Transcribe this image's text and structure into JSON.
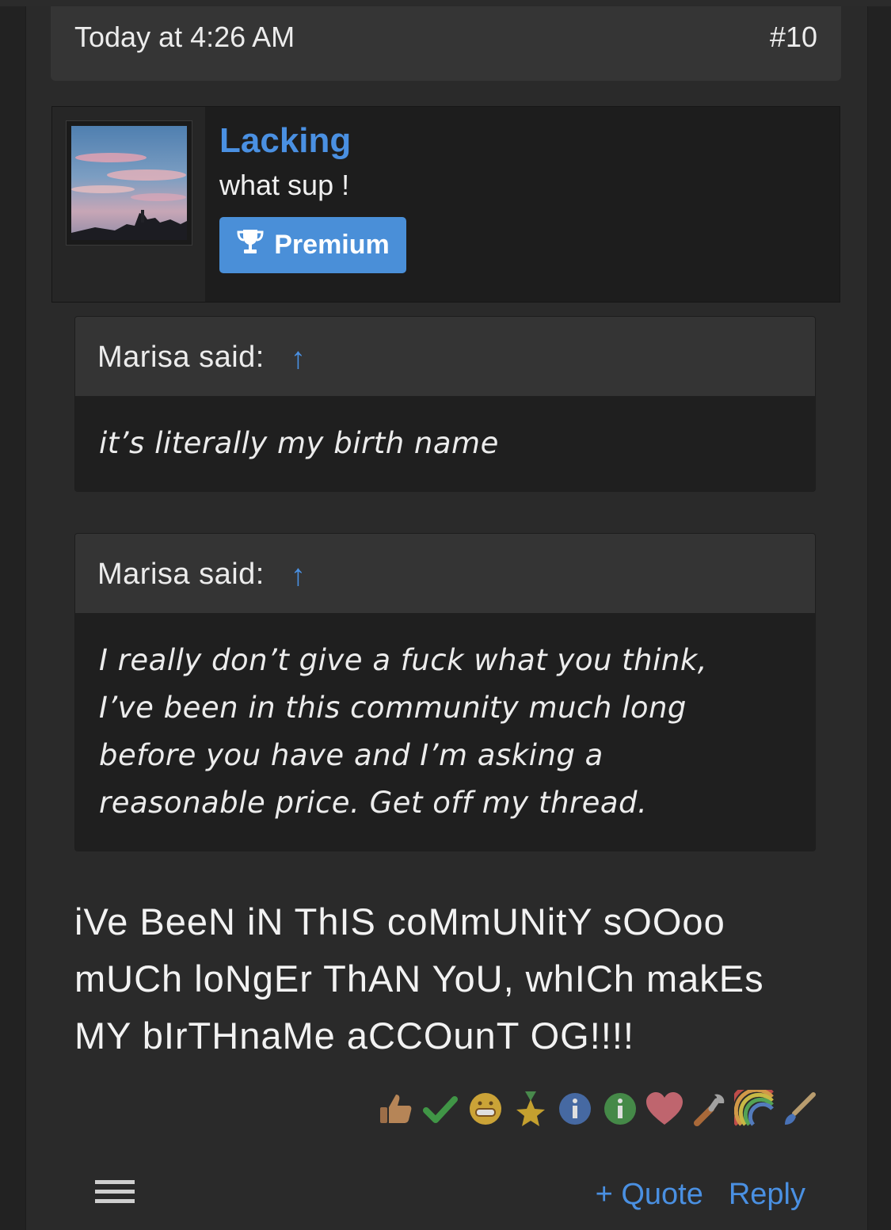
{
  "post": {
    "date": "Today at 4:26 AM",
    "number": "#10"
  },
  "user": {
    "name": "Lacking",
    "title": "what sup !",
    "badge": "Premium",
    "badge_icon": "trophy-icon",
    "link_color": "#4a90e2",
    "badge_color": "#4a8fd8"
  },
  "quotes": [
    {
      "author": "Marisa said:",
      "arrow": "↑",
      "lines": [
        "it’s literally my birth name"
      ]
    },
    {
      "author": "Marisa said:",
      "arrow": "↑",
      "lines": [
        "I really don’t give a fuck what you think,",
        "I’ve been in this community much long",
        "before you have and I’m asking a",
        "reasonable price. Get off my thread."
      ]
    }
  ],
  "message": {
    "lines": [
      "iVe BeeN iN ThIS coMmUNitY sOOoo",
      "mUCh loNgEr ThAN YoU, whICh makEs",
      "MY bIrTHnaMe aCCOunT OG!!!!"
    ]
  },
  "reactions": [
    "thumbs-up-icon",
    "checkmark-icon",
    "grin-icon",
    "star-medal-icon",
    "info-blue-icon",
    "info-green-icon",
    "heart-icon",
    "wrench-icon",
    "rainbow-icon",
    "paintbrush-icon"
  ],
  "actions": {
    "quote": "+ Quote",
    "reply": "Reply"
  }
}
